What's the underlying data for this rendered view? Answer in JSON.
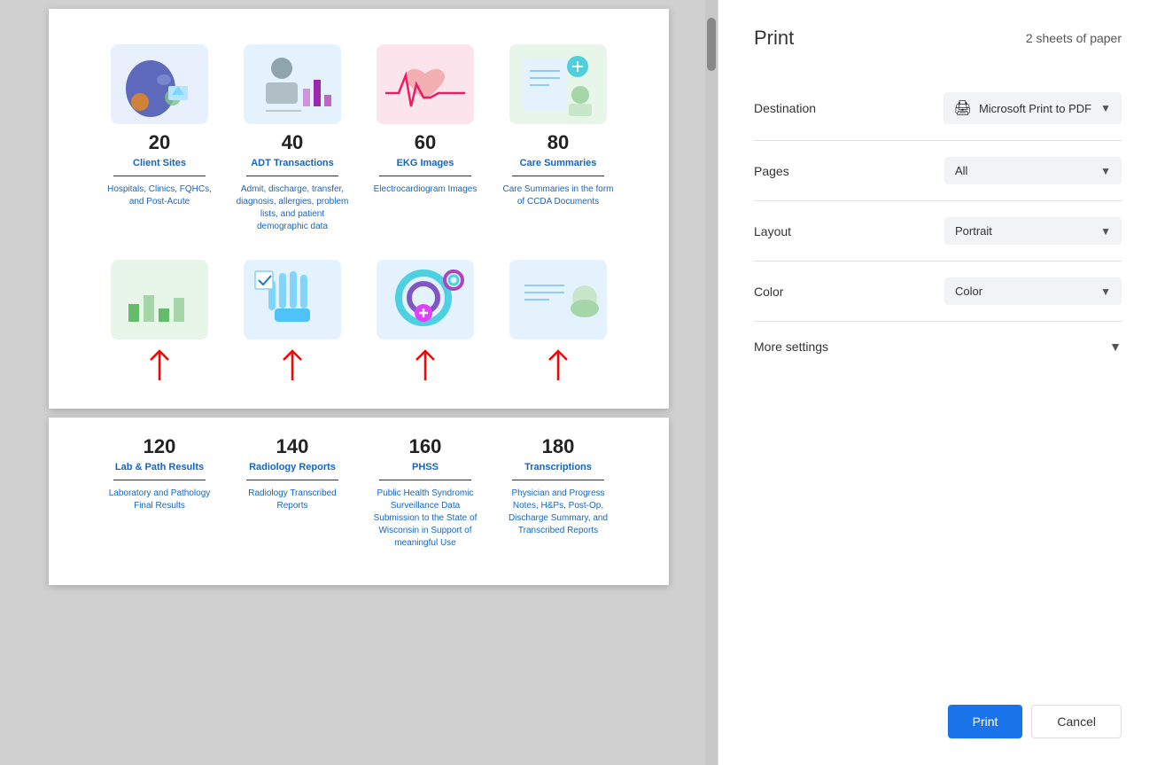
{
  "print": {
    "title": "Print",
    "sheets": "2 sheets of paper",
    "destination_label": "Destination",
    "destination_value": "Microsoft Print to PDF",
    "pages_label": "Pages",
    "pages_value": "All",
    "layout_label": "Layout",
    "layout_value": "Portrait",
    "color_label": "Color",
    "color_value": "Color",
    "more_settings_label": "More settings",
    "print_button": "Print",
    "cancel_button": "Cancel"
  },
  "cards_top": [
    {
      "number": "20",
      "title": "Client Sites",
      "desc": "Hospitals, Clinics, FQHCs, and Post-Acute",
      "icon_type": "wisconsin"
    },
    {
      "number": "40",
      "title": "ADT Transactions",
      "desc": "Admit, discharge, transfer, diagnosis, allergies, problem lists, and patient demographic data",
      "icon_type": "adt"
    },
    {
      "number": "60",
      "title": "EKG Images",
      "desc": "Electrocardiogram Images",
      "icon_type": "ekg"
    },
    {
      "number": "80",
      "title": "Care Summaries",
      "desc": "Care Summaries in the form of CCDA Documents",
      "icon_type": "care"
    }
  ],
  "cards_bottom": [
    {
      "number": "120",
      "title": "Lab & Path Results",
      "desc": "Laboratory and Pathology Final Results",
      "icon_type": "lab"
    },
    {
      "number": "140",
      "title": "Radiology Reports",
      "desc": "Radiology Transcribed Reports",
      "icon_type": "radio"
    },
    {
      "number": "160",
      "title": "PHSS",
      "desc": "Public Health Syndromic Surveillance Data Submission to the State of Wisconsin in Support of meaningful Use",
      "icon_type": "phss"
    },
    {
      "number": "180",
      "title": "Transcriptions",
      "desc": "Physician and Progress Notes, H&Ps, Post-Op, Discharge Summary, and Transcribed Reports",
      "icon_type": "trans"
    }
  ]
}
